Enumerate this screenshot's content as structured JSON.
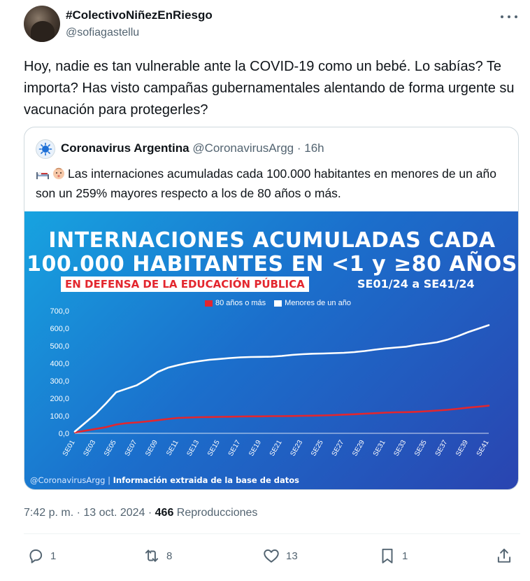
{
  "tweet": {
    "display_name": "#ColectivoNiñezEnRiesgo",
    "handle": "@sofiagastellu",
    "text": "Hoy, nadie es tan vulnerable ante la COVID-19 como un bebé. Lo sabías? Te importa? Has visto campañas gubernamentales alentando de forma urgente su vacunación para protegerles?",
    "timestamp": "7:42 p. m. · 13 oct. 2024 · ",
    "views_count": "466",
    "views_label": " Reproducciones"
  },
  "quote": {
    "display_name": "Coronavirus Argentina",
    "handle": "@CoronavirusArgg",
    "age": " · 16h",
    "text": "Las internaciones acumuladas cada 100.000 habitantes en menores de un año son un 259% mayores respecto a los de 80 años o más."
  },
  "infographic": {
    "title_line1": "INTERNACIONES ACUMULADAS CADA",
    "title_line2": "100.000 HABITANTES EN <1 y ≥80 AÑOS",
    "banner": "EN DEFENSA DE LA EDUCACIÓN PÚBLICA",
    "period": "SE01/24 a SE41/24",
    "footer_handle": "@CoronavirusArgg",
    "footer_sep": " | ",
    "footer_source": "Información extraida de la base de datos"
  },
  "chart_data": {
    "type": "line",
    "x": [
      "SE01",
      "SE02",
      "SE03",
      "SE04",
      "SE05",
      "SE06",
      "SE07",
      "SE08",
      "SE09",
      "SE10",
      "SE11",
      "SE12",
      "SE13",
      "SE14",
      "SE15",
      "SE16",
      "SE17",
      "SE18",
      "SE19",
      "SE20",
      "SE21",
      "SE22",
      "SE23",
      "SE24",
      "SE25",
      "SE26",
      "SE27",
      "SE28",
      "SE29",
      "SE30",
      "SE31",
      "SE32",
      "SE33",
      "SE34",
      "SE35",
      "SE36",
      "SE37",
      "SE38",
      "SE39",
      "SE40",
      "SE41"
    ],
    "x_tick_labels": [
      "SE01",
      "SE03",
      "SE05",
      "SE07",
      "SE09",
      "SE11",
      "SE13",
      "SE15",
      "SE17",
      "SE19",
      "SE21",
      "SE23",
      "SE25",
      "SE27",
      "SE29",
      "SE31",
      "SE33",
      "SE35",
      "SE37",
      "SE39",
      "SE41"
    ],
    "series": [
      {
        "name": "80 años o más",
        "color": "#e3262e",
        "values": [
          5,
          15,
          25,
          35,
          50,
          58,
          62,
          68,
          75,
          82,
          88,
          90,
          92,
          93,
          94,
          95,
          96,
          97,
          97,
          98,
          98,
          99,
          100,
          101,
          102,
          104,
          107,
          109,
          112,
          115,
          118,
          120,
          121,
          123,
          126,
          130,
          134,
          140,
          147,
          152,
          158
        ]
      },
      {
        "name": "Menores de un año",
        "color": "#ffffff",
        "values": [
          10,
          60,
          110,
          170,
          235,
          255,
          275,
          310,
          350,
          375,
          390,
          403,
          412,
          420,
          425,
          430,
          434,
          436,
          437,
          438,
          442,
          448,
          452,
          455,
          456,
          458,
          460,
          464,
          470,
          478,
          485,
          490,
          495,
          505,
          512,
          520,
          535,
          555,
          578,
          598,
          618
        ]
      }
    ],
    "yticks": [
      "0,0",
      "100,0",
      "200,0",
      "300,0",
      "400,0",
      "500,0",
      "600,0",
      "700,0"
    ],
    "ylim": [
      0,
      700
    ]
  },
  "actions": {
    "reply_count": "1",
    "retweet_count": "8",
    "like_count": "13",
    "bookmark_count": "1"
  }
}
